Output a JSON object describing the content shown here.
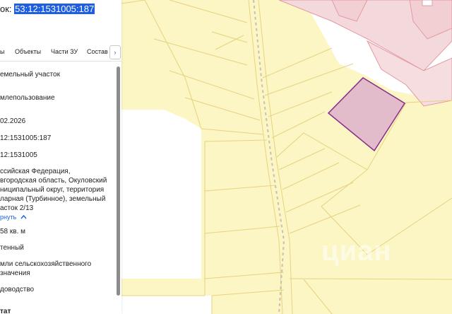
{
  "header": {
    "prefix": "ок:",
    "cadastral_number": "53:12:1531005:187"
  },
  "tabs": [
    {
      "label": "ы"
    },
    {
      "label": "Объекты"
    },
    {
      "label": "Части ЗУ"
    },
    {
      "label": "Состав"
    }
  ],
  "tabs_more": "›",
  "fields": {
    "type": "емельный участок",
    "use": "млепользование",
    "date": "02.2026",
    "number": "12:1531005:187",
    "quarter": "12:1531005",
    "address_lines": [
      "ссийская Федерация,",
      "вгородская область, Окуловский",
      "ниципальный округ, территория",
      "ларная (Турбинное), земельный",
      "асток 2/13"
    ],
    "collapse_link": "рнуть",
    "area": "58 кв. м",
    "status": "тенный",
    "category_lines": [
      "мли сельскохозяйственного",
      "значения"
    ],
    "permitted_use": "доводство",
    "bottom_partial": "тат"
  },
  "watermark": "циан",
  "colors": {
    "map_bg": "#fbf6c4",
    "parcel_line": "#e7d27f",
    "selected_parcel_fill": "#e2bccb",
    "selected_parcel_stroke": "#8a2a8a",
    "building_fill": "#f4d9dc",
    "building_stroke": "#e39aa0",
    "road": "#ffffff",
    "link": "#1d5fe0"
  }
}
